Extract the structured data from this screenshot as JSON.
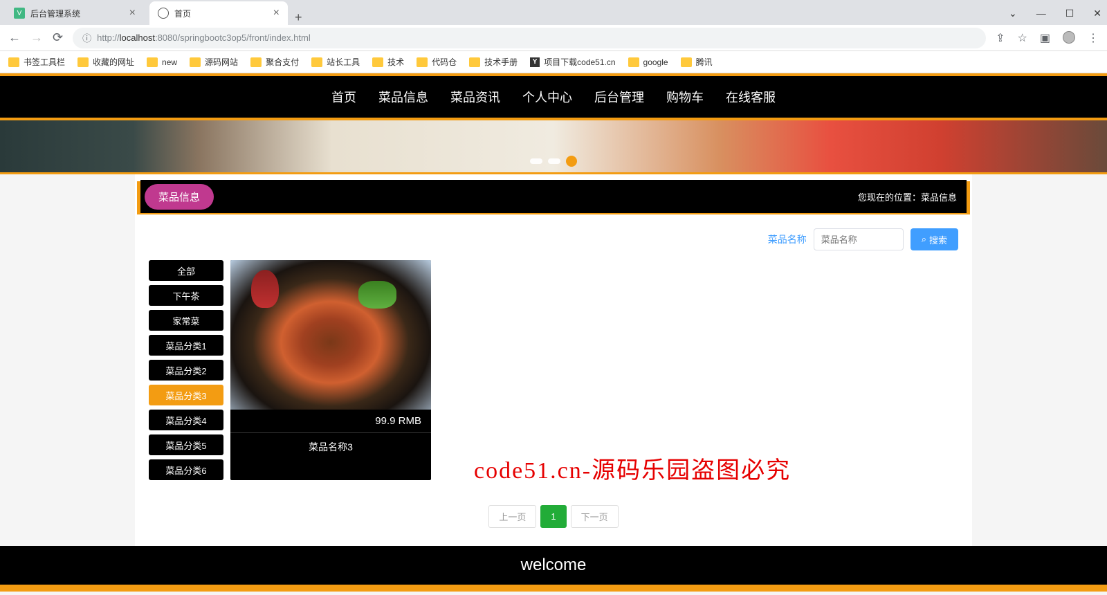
{
  "tabs": [
    {
      "title": "后台管理系统"
    },
    {
      "title": "首页"
    }
  ],
  "url": {
    "prefix": "http://",
    "host": "localhost",
    "rest": ":8080/springbootc3op5/front/index.html"
  },
  "bookmarks": [
    "书签工具栏",
    "收藏的网址",
    "new",
    "源码网站",
    "聚合支付",
    "站长工具",
    "技术",
    "代码仓",
    "技术手册",
    "项目下载code51.cn",
    "google",
    "腾讯"
  ],
  "nav": [
    "首页",
    "菜品信息",
    "菜品资讯",
    "个人中心",
    "后台管理",
    "购物车",
    "在线客服"
  ],
  "crumb": {
    "pill": "菜品信息",
    "location_label": "您现在的位置：",
    "location_value": "菜品信息"
  },
  "search": {
    "label": "菜品名称",
    "placeholder": "菜品名称",
    "button": "搜索"
  },
  "categories": [
    "全部",
    "下午茶",
    "家常菜",
    "菜品分类1",
    "菜品分类2",
    "菜品分类3",
    "菜品分类4",
    "菜品分类5",
    "菜品分类6"
  ],
  "active_category_index": 5,
  "product": {
    "price": "99.9 RMB",
    "name": "菜品名称3"
  },
  "pagination": {
    "prev": "上一页",
    "current": "1",
    "next": "下一页"
  },
  "watermark": "code51.cn-源码乐园盗图必究",
  "footer": "welcome"
}
